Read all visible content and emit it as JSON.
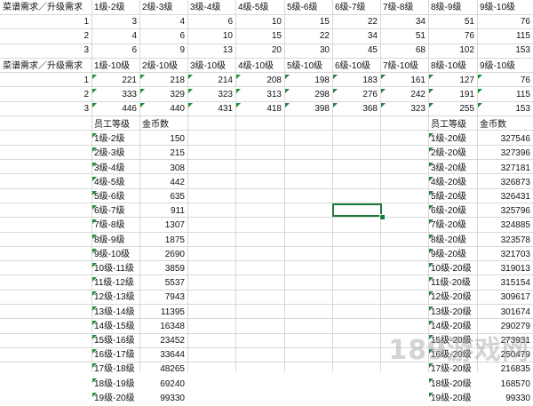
{
  "table1": {
    "corner": "菜谱需求／升级需求",
    "headers": [
      "1级-2级",
      "2级-3级",
      "3级-4级",
      "4级-5级",
      "5级-6级",
      "6级-7级",
      "7级-8级",
      "8级-9级",
      "9级-10级"
    ],
    "rows": [
      {
        "label": "1",
        "values": [
          "3",
          "4",
          "6",
          "10",
          "15",
          "22",
          "34",
          "51",
          "76"
        ]
      },
      {
        "label": "2",
        "values": [
          "4",
          "6",
          "10",
          "15",
          "22",
          "34",
          "51",
          "76",
          "115"
        ]
      },
      {
        "label": "3",
        "values": [
          "6",
          "9",
          "13",
          "20",
          "30",
          "45",
          "68",
          "102",
          "153"
        ]
      }
    ]
  },
  "table2": {
    "corner": "菜谱需求／升级需求",
    "headers": [
      "1级-10级",
      "2级-10级",
      "3级-10级",
      "4级-10级",
      "5级-10级",
      "6级-10级",
      "7级-10级",
      "8级-10级",
      "9级-10级"
    ],
    "rows": [
      {
        "label": "1",
        "values": [
          "221",
          "218",
          "214",
          "208",
          "198",
          "183",
          "161",
          "127",
          "76"
        ]
      },
      {
        "label": "2",
        "values": [
          "333",
          "329",
          "323",
          "313",
          "298",
          "276",
          "242",
          "191",
          "115"
        ]
      },
      {
        "label": "3",
        "values": [
          "446",
          "440",
          "431",
          "418",
          "398",
          "368",
          "323",
          "255",
          "153"
        ]
      }
    ]
  },
  "table3": {
    "headers": [
      "员工等级",
      "金币数"
    ],
    "rows": [
      [
        "1级-2级",
        "150"
      ],
      [
        "2级-3级",
        "215"
      ],
      [
        "3级-4级",
        "308"
      ],
      [
        "4级-5级",
        "442"
      ],
      [
        "5级-6级",
        "635"
      ],
      [
        "6级-7级",
        "911"
      ],
      [
        "7级-8级",
        "1307"
      ],
      [
        "8级-9级",
        "1875"
      ],
      [
        "9级-10级",
        "2690"
      ],
      [
        "10级-11级",
        "3859"
      ],
      [
        "11级-12级",
        "5537"
      ],
      [
        "12级-13级",
        "7943"
      ],
      [
        "13级-14级",
        "11395"
      ],
      [
        "14级-15级",
        "16348"
      ],
      [
        "15级-16级",
        "23452"
      ],
      [
        "16级-17级",
        "33644"
      ],
      [
        "17级-18级",
        "48265"
      ],
      [
        "18级-19级",
        "69240"
      ],
      [
        "19级-20级",
        "99330"
      ]
    ]
  },
  "table4": {
    "headers": [
      "员工等级",
      "金币数"
    ],
    "rows": [
      [
        "1级-20级",
        "327546"
      ],
      [
        "2级-20级",
        "327396"
      ],
      [
        "3级-20级",
        "327181"
      ],
      [
        "4级-20级",
        "326873"
      ],
      [
        "5级-20级",
        "326431"
      ],
      [
        "6级-20级",
        "325796"
      ],
      [
        "7级-20级",
        "324885"
      ],
      [
        "8级-20级",
        "323578"
      ],
      [
        "9级-20级",
        "321703"
      ],
      [
        "10级-20级",
        "319013"
      ],
      [
        "11级-20级",
        "315154"
      ],
      [
        "12级-20级",
        "309617"
      ],
      [
        "13级-20级",
        "301674"
      ],
      [
        "14级-20级",
        "290279"
      ],
      [
        "15级-20级",
        "273931"
      ],
      [
        "16级-20级",
        "250479"
      ],
      [
        "17级-20级",
        "216835"
      ],
      [
        "18级-20级",
        "168570"
      ],
      [
        "19级-20级",
        "99330"
      ]
    ]
  },
  "watermark": "189游戏网",
  "colors": {
    "grid": "#d8d8d8",
    "selection": "#1e7a3c",
    "marker": "#1f8a3a"
  }
}
